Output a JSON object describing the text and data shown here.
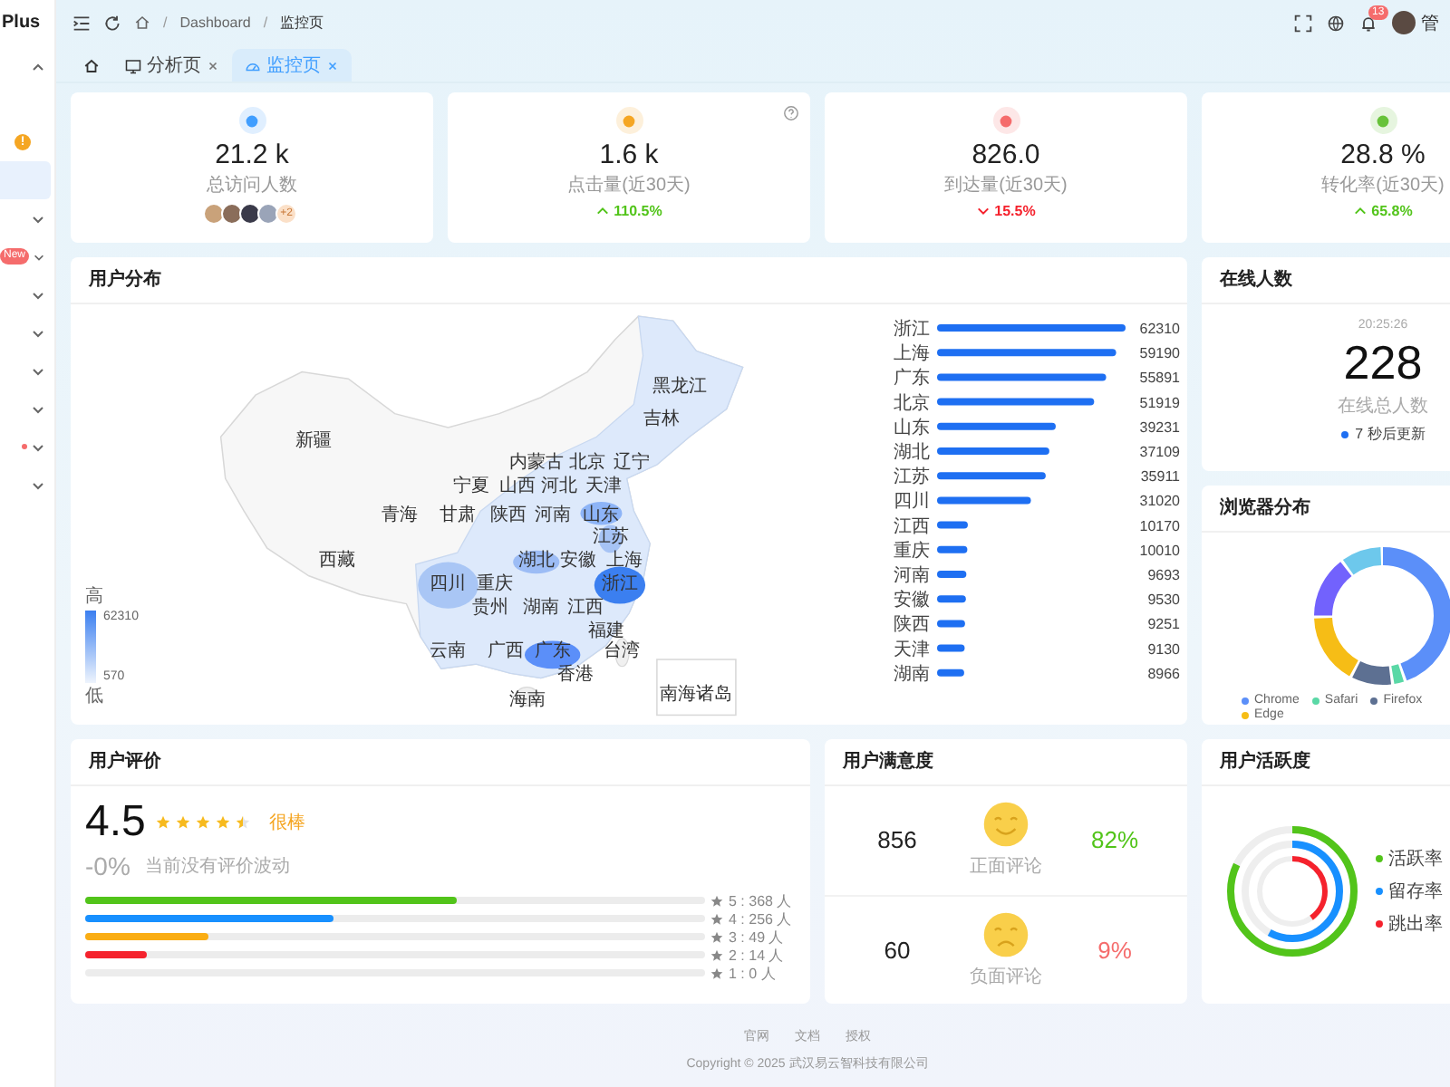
{
  "sidebar": {
    "logo": "Plus",
    "items": [
      {
        "kind": "group",
        "expanded": true,
        "selected": false
      },
      {
        "kind": "leaf",
        "badge": "!",
        "selected": false
      },
      {
        "kind": "leaf",
        "selected": true
      },
      {
        "kind": "group",
        "expanded": false,
        "selected": false
      },
      {
        "kind": "group",
        "expanded": false,
        "badge": "New",
        "selected": false
      },
      {
        "kind": "group",
        "expanded": false,
        "selected": false
      },
      {
        "kind": "group",
        "expanded": false,
        "selected": false
      },
      {
        "kind": "group",
        "expanded": false,
        "selected": false
      },
      {
        "kind": "group",
        "expanded": false,
        "selected": false
      },
      {
        "kind": "group",
        "expanded": false,
        "dot": true,
        "selected": false
      },
      {
        "kind": "group",
        "expanded": false,
        "selected": false
      }
    ]
  },
  "header": {
    "separator": "/",
    "breadcrumbs": [
      "Dashboard",
      "监控页"
    ],
    "notification_count": "13",
    "user_name": "管"
  },
  "tabs": [
    {
      "kind": "home",
      "selected": false
    },
    {
      "kind": "page",
      "label": "分析页",
      "selected": false
    },
    {
      "kind": "page",
      "label": "监控页",
      "selected": true
    }
  ],
  "stats": [
    {
      "kind": "avatars",
      "value": "21.2 k",
      "label": "总访问人数",
      "color": "#409eff",
      "more": "+2"
    },
    {
      "kind": "trend",
      "value": "1.6 k",
      "label": "点击量(近30天)",
      "color": "#f5a623",
      "help": true,
      "trend": {
        "rising": true,
        "text": "110.5%"
      }
    },
    {
      "kind": "trend",
      "value": "826.0",
      "label": "到达量(近30天)",
      "color": "#f56c6c",
      "trend": {
        "rising": false,
        "text": "15.5%"
      }
    },
    {
      "kind": "trend",
      "value": "28.8 %",
      "label": "转化率(近30天)",
      "color": "#67c23a",
      "trend": {
        "rising": true,
        "text": "65.8%"
      }
    }
  ],
  "user_distribution": {
    "title": "用户分布",
    "map_labels": [
      "黑龙江",
      "吉林",
      "新疆",
      "内蒙古",
      "北京",
      "辽宁",
      "宁夏",
      "山西",
      "河北",
      "天津",
      "青海",
      "甘肃",
      "陕西",
      "河南",
      "山东",
      "江苏",
      "西藏",
      "湖北",
      "安徽",
      "上海",
      "四川",
      "重庆",
      "浙江",
      "贵州",
      "湖南",
      "江西",
      "福建",
      "云南",
      "广西",
      "广东",
      "台湾",
      "香港",
      "海南",
      "南海诸岛"
    ],
    "legend": {
      "high": "高",
      "max": "62310",
      "min": "570",
      "low": "低"
    },
    "chart_data": {
      "type": "bar",
      "orientation": "horizontal",
      "data_labels": true,
      "categories": [
        "浙江",
        "上海",
        "广东",
        "北京",
        "山东",
        "湖北",
        "江苏",
        "四川",
        "江西",
        "重庆",
        "河南",
        "安徽",
        "陕西",
        "天津",
        "湖南"
      ],
      "values": [
        62310,
        59190,
        55891,
        51919,
        39231,
        37109,
        35911,
        31020,
        10170,
        10010,
        9693,
        9530,
        9251,
        9130,
        8966
      ]
    }
  },
  "online": {
    "title": "在线人数",
    "time": "20:25:26",
    "count": "228",
    "label": "在线总人数",
    "note": "7 秒后更新"
  },
  "browsers": {
    "title": "浏览器分布",
    "legend": [
      {
        "label": "Chrome",
        "color": "#5b8ff9"
      },
      {
        "label": "Safari",
        "color": "#5ad8a6"
      },
      {
        "label": "Firefox",
        "color": "#5d7092"
      },
      {
        "label": "Edge",
        "color": "#f6bd16"
      }
    ]
  },
  "rating": {
    "title": "用户评价",
    "score": "4.5",
    "stars": 4.5,
    "tag": "很棒",
    "change": "-0%",
    "note": "当前没有评价波动",
    "rows": [
      {
        "label": "5 : 368 人",
        "level": 0.6,
        "color": "#52c41a"
      },
      {
        "label": "4 : 256 人",
        "level": 0.4,
        "color": "#1890ff"
      },
      {
        "label": "3 : 49 人",
        "level": 0.2,
        "color": "#faad14"
      },
      {
        "label": "2 : 14 人",
        "level": 0.1,
        "color": "#f5222d"
      },
      {
        "label": "1 : 0 人"
      }
    ]
  },
  "satisfaction": {
    "title": "用户满意度",
    "rows": [
      {
        "kind": "positive",
        "count": "856",
        "label": "正面评论",
        "percent": "82%"
      },
      {
        "kind": "negative",
        "count": "60",
        "label": "负面评论",
        "percent": "9%"
      }
    ]
  },
  "activity": {
    "title": "用户活跃度",
    "legend": [
      {
        "label": "活跃率",
        "color": "#52c41a"
      },
      {
        "label": "留存率",
        "color": "#1890ff"
      },
      {
        "label": "跳出率",
        "color": "#f5222d"
      }
    ]
  },
  "footer": {
    "links": [
      "官网",
      "文档",
      "授权"
    ],
    "copyright": "Copyright © 2025 武汉易云智科技有限公司"
  }
}
